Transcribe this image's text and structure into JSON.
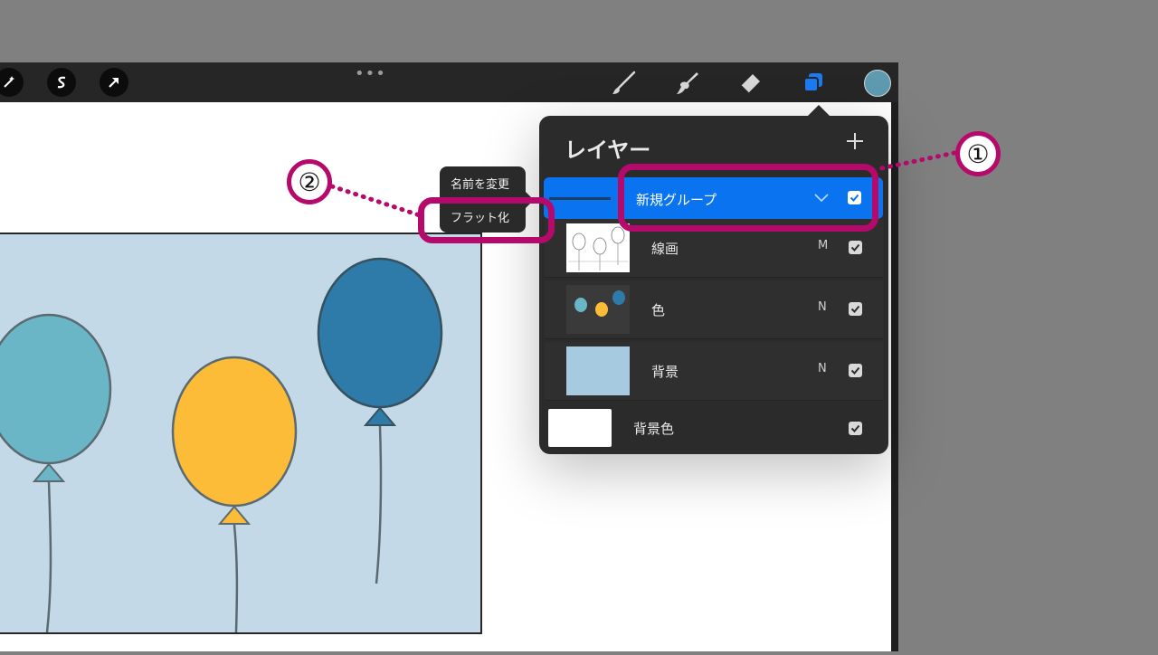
{
  "toolbar": {
    "left_tools": [
      "magic-wand-icon",
      "selection-icon",
      "transform-arrow-icon"
    ],
    "more_menu": "•••",
    "right_tools": [
      "brush-icon",
      "smudge-icon",
      "eraser-icon",
      "layers-icon"
    ],
    "current_color": "#5e9bb0"
  },
  "layers_panel": {
    "title": "レイヤー",
    "group": {
      "name": "新規グループ",
      "checked": true
    },
    "layers": [
      {
        "name": "線画",
        "mode": "M",
        "checked": true
      },
      {
        "name": "色",
        "mode": "N",
        "checked": true
      },
      {
        "name": "背景",
        "mode": "N",
        "checked": true
      }
    ],
    "background": {
      "name": "背景色",
      "checked": true
    }
  },
  "context_menu": {
    "rename": "名前を変更",
    "flatten": "フラット化"
  },
  "annotations": {
    "badge_1": "①",
    "badge_2": "②",
    "highlight_color": "#b5096b"
  },
  "balloon_colors": [
    "#6ab6c7",
    "#fcbc38",
    "#2e7ba9"
  ],
  "canvas_bg_color": "#c4d9e8"
}
